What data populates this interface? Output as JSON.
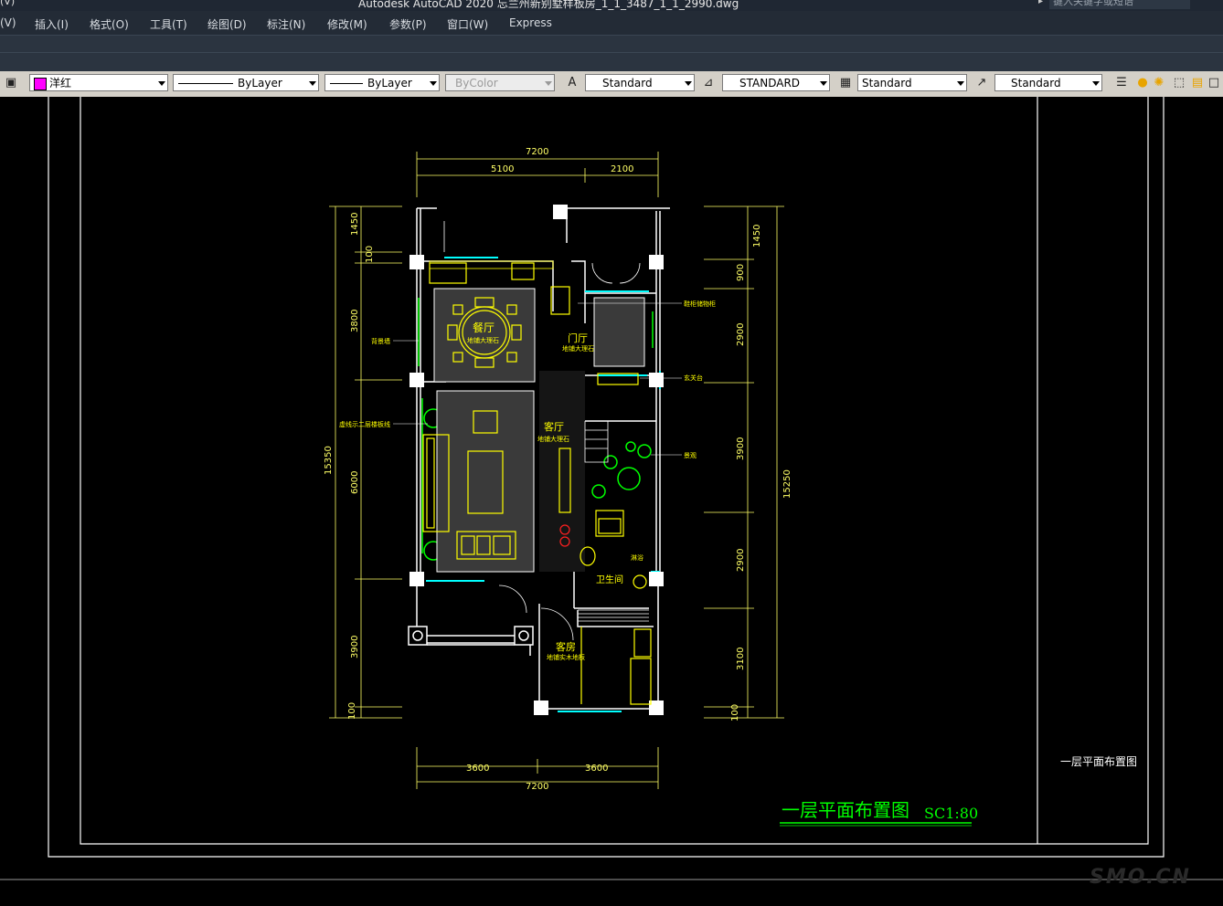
{
  "window": {
    "quick_access": "(V)",
    "title": "Autodesk AutoCAD 2020    忘兰州新别墅样板房_1_1_3487_1_1_2990.dwg",
    "search_placeholder": "键入关键字或短语"
  },
  "menu": {
    "items": [
      "(V)",
      "插入(I)",
      "格式(O)",
      "工具(T)",
      "绘图(D)",
      "标注(N)",
      "修改(M)",
      "参数(P)",
      "窗口(W)",
      "Express"
    ]
  },
  "toolbar": {
    "color_value": "洋红",
    "color_swatch": "#ff00ff",
    "linetype_value": "ByLayer",
    "lineweight_value": "ByLayer",
    "plotstyle_value": "ByColor",
    "text_style": "Standard",
    "dim_style": "STANDARD",
    "table_style": "Standard",
    "mleader_style": "Standard"
  },
  "drawing": {
    "title": "一层平面布置图",
    "scale": "SC1:80",
    "titleblock_label": "一层平面布置图",
    "dims_top": [
      "7200",
      "5100",
      "2100"
    ],
    "dims_bottom": [
      "3600",
      "3600",
      "7200"
    ],
    "dims_left": [
      "1450",
      "100",
      "3800",
      "15350",
      "6000",
      "3900",
      "100"
    ],
    "dims_right": [
      "1450",
      "900",
      "2900",
      "3900",
      "15250",
      "2900",
      "3100",
      "100"
    ],
    "rooms": {
      "dining": "餐厅",
      "dining_floor": "地铺大理石",
      "foyer": "门厅",
      "foyer_floor": "地铺大理石",
      "living": "客厅",
      "living_floor": "地铺大理石",
      "bath": "卫生间",
      "guest": "客房",
      "guest_floor": "地铺实木地板"
    },
    "notes": {
      "left_wall": "背景墙",
      "stair_note": "虚线示二层楼板线",
      "right_top": "鞋柜储物柜",
      "right_mid": "玄关台",
      "right_garden": "景观",
      "bath_item": "淋浴"
    }
  },
  "colors": {
    "wall": "#ffffff",
    "furniture": "#ffff00",
    "dim": "#ffff66",
    "window": "#00ffff",
    "green": "#00ff00",
    "title_green": "#00ff00"
  },
  "watermark": "SMO.CN"
}
